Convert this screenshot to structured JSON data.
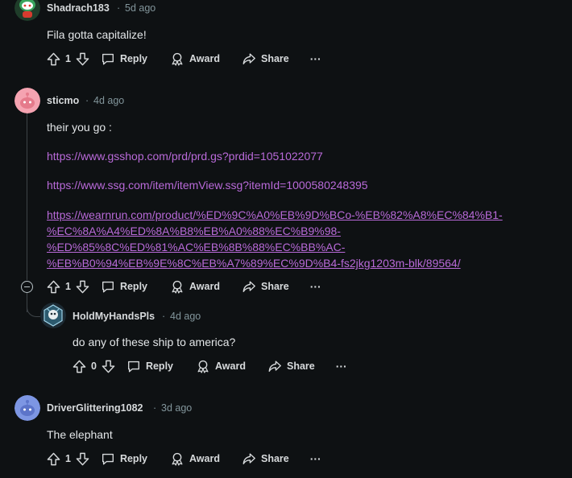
{
  "colors": {
    "background": "#0e1113",
    "link": "#b96ad9",
    "meta": "#82959b",
    "text": "#d7dadc"
  },
  "comments": [
    {
      "username": "Shadrach183",
      "time": "5d ago",
      "body": "Fila gotta capitalize!",
      "score": "1",
      "avatar_icon": "snoo-avatar-icon"
    },
    {
      "username": "sticmo",
      "time": "4d ago",
      "body": "their you go :",
      "links": [
        "https://www.gsshop.com/prd/prd.gs?prdid=1051022077",
        "https://www.ssg.com/item/itemView.ssg?itemId=1000580248395"
      ],
      "long_link": [
        "https://wearnrun.com/product/%ED%9C%A0%EB%9D%BCo-%EB%82%A8%EC%84%B1-",
        "%EC%8A%A4%ED%8A%B8%EB%A0%88%EC%B9%98-",
        "%ED%85%8C%ED%81%AC%EB%8B%88%EC%BB%AC-",
        "%EB%B0%94%EB%9E%8C%EB%A7%89%EC%9D%B4-fs2jkg1203m-blk/89564/"
      ],
      "score": "1",
      "avatar_icon": "snoo-avatar-icon"
    },
    {
      "username": "HoldMyHandsPls",
      "time": "4d ago",
      "body": "do any of these ship to america?",
      "score": "0",
      "avatar_icon": "hexagon-avatar-icon"
    },
    {
      "username": "DriverGlittering1082",
      "time": "3d ago",
      "body": "The elephant",
      "score": "1",
      "avatar_icon": "snoo-avatar-icon"
    }
  ],
  "actions": {
    "reply": "Reply",
    "award": "Award",
    "share": "Share",
    "more": "···",
    "separator": "·"
  }
}
